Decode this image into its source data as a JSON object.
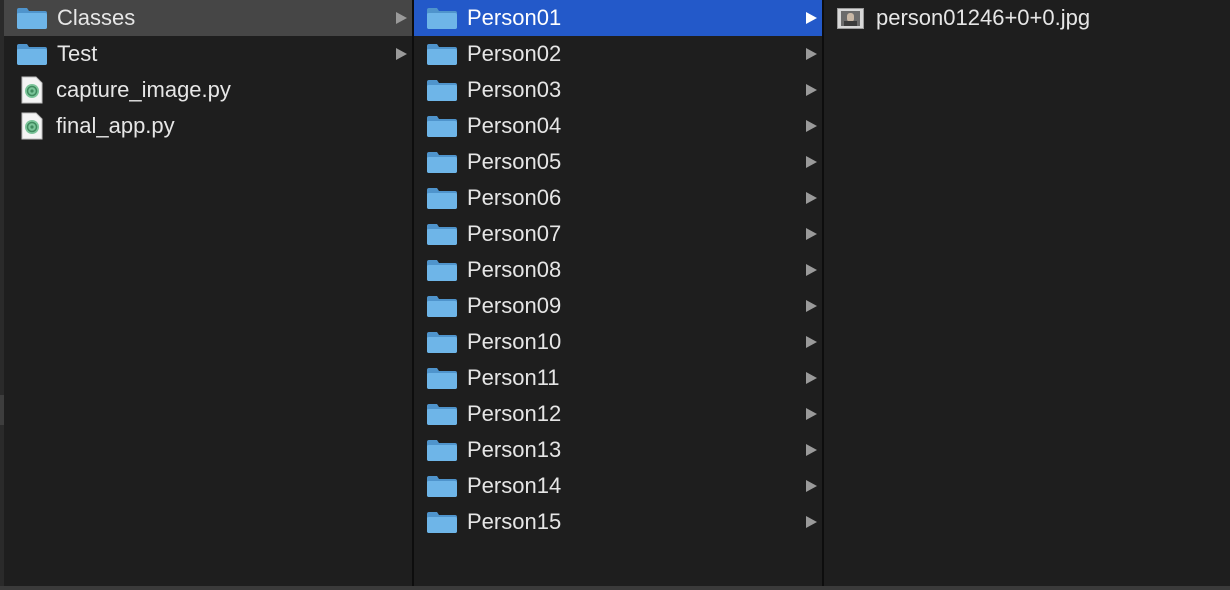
{
  "columns": {
    "col1": {
      "items": [
        {
          "label": "Classes",
          "kind": "folder",
          "icon": "folder-icon",
          "has_children": true,
          "state": "path-selected"
        },
        {
          "label": "Test",
          "kind": "folder",
          "icon": "folder-icon",
          "has_children": true,
          "state": "normal"
        },
        {
          "label": "capture_image.py",
          "kind": "file",
          "icon": "python-file-icon",
          "has_children": false,
          "state": "normal"
        },
        {
          "label": "final_app.py",
          "kind": "file",
          "icon": "python-file-icon",
          "has_children": false,
          "state": "normal"
        }
      ]
    },
    "col2": {
      "items": [
        {
          "label": "Person01",
          "state": "selected"
        },
        {
          "label": "Person02"
        },
        {
          "label": "Person03"
        },
        {
          "label": "Person04"
        },
        {
          "label": "Person05"
        },
        {
          "label": "Person06"
        },
        {
          "label": "Person07"
        },
        {
          "label": "Person08"
        },
        {
          "label": "Person09"
        },
        {
          "label": "Person10"
        },
        {
          "label": "Person11"
        },
        {
          "label": "Person12"
        },
        {
          "label": "Person13"
        },
        {
          "label": "Person14"
        },
        {
          "label": "Person15"
        }
      ]
    },
    "col3": {
      "items": [
        {
          "label": "person01246+0+0.jpg",
          "kind": "image",
          "icon": "image-thumbnail-icon"
        }
      ]
    }
  },
  "colors": {
    "background": "#1e1e1e",
    "selection_active": "#2359c9",
    "selection_inactive": "#464646",
    "text": "#e6e6e6",
    "folder": "#5fa8e0"
  }
}
